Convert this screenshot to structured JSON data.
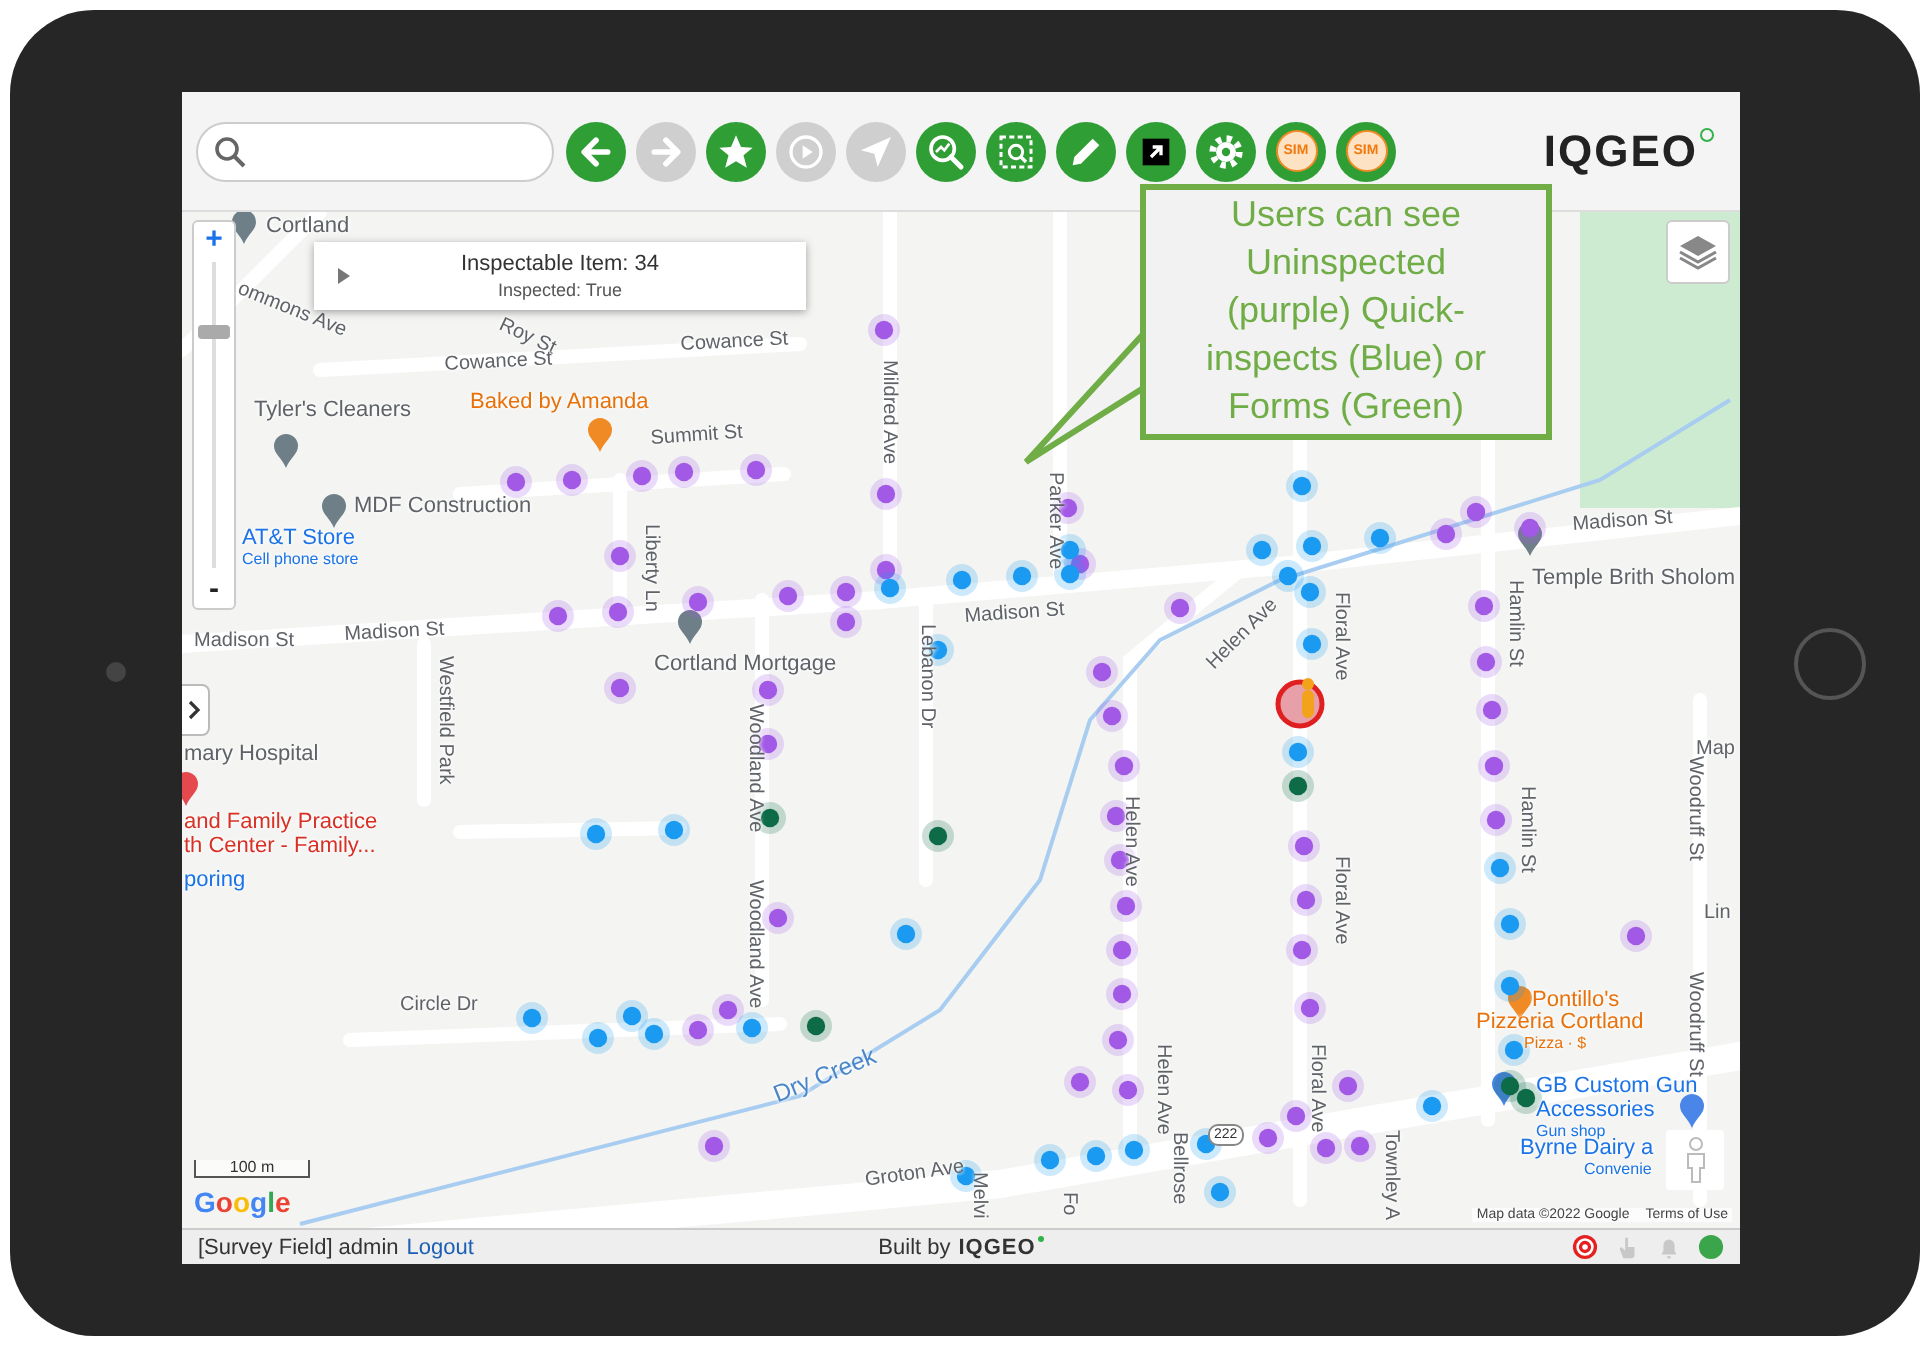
{
  "toolbar": {
    "buttons": [
      {
        "kind": "back",
        "disabled": false
      },
      {
        "kind": "forward",
        "disabled": true
      },
      {
        "kind": "star",
        "disabled": false
      },
      {
        "kind": "play",
        "disabled": true
      },
      {
        "kind": "locate",
        "disabled": true
      },
      {
        "kind": "zoom-chart",
        "disabled": false
      },
      {
        "kind": "zoom-select",
        "disabled": false
      },
      {
        "kind": "pencil",
        "disabled": false
      },
      {
        "kind": "export",
        "disabled": false
      },
      {
        "kind": "gear",
        "disabled": false
      },
      {
        "kind": "sim",
        "label": "SIM",
        "disabled": false
      },
      {
        "kind": "sim",
        "label": "SIM",
        "disabled": false
      }
    ],
    "logo": "IQGEO"
  },
  "callout": {
    "text": "Users can see Uninspected (purple) Quick-inspects (Blue) or Forms (Green)"
  },
  "popup": {
    "title": "Inspectable Item: 34",
    "subtitle": "Inspected: True"
  },
  "zoom": {
    "in": "+",
    "out": "-",
    "level": 0.77
  },
  "map_labels": [
    {
      "text": "Cortland",
      "kind": "place"
    },
    {
      "text": "ommons Ave",
      "kind": "street"
    },
    {
      "text": "Roy St",
      "kind": "street"
    },
    {
      "text": "Cowance St",
      "kind": "street"
    },
    {
      "text": "Cowance St",
      "kind": "street"
    },
    {
      "text": "Tyler's Cleaners",
      "kind": "place"
    },
    {
      "text": "Baked by Amanda",
      "kind": "food"
    },
    {
      "text": "Summit St",
      "kind": "street"
    },
    {
      "text": "MDF Construction",
      "kind": "place"
    },
    {
      "text": "AT&T Store",
      "kind": "blue"
    },
    {
      "text": "Cell phone store",
      "kind": "blue-small"
    },
    {
      "text": "Madison St",
      "kind": "street"
    },
    {
      "text": "Madison St",
      "kind": "street"
    },
    {
      "text": "Liberty Ln",
      "kind": "street"
    },
    {
      "text": "Madison St",
      "kind": "street"
    },
    {
      "text": "Madison St",
      "kind": "street"
    },
    {
      "text": "Cortland Mortgage",
      "kind": "place"
    },
    {
      "text": "Westfield Park",
      "kind": "street"
    },
    {
      "text": "Woodland Ave",
      "kind": "street"
    },
    {
      "text": "Mildred Ave",
      "kind": "street"
    },
    {
      "text": "Parker Ave",
      "kind": "street"
    },
    {
      "text": "Lebanon Dr",
      "kind": "street"
    },
    {
      "text": "Helen Ave",
      "kind": "street"
    },
    {
      "text": "Floral Ave",
      "kind": "street"
    },
    {
      "text": "Hamlin St",
      "kind": "street"
    },
    {
      "text": "Temple Brith Sholom",
      "kind": "place"
    },
    {
      "text": "mary Hospital",
      "kind": "place"
    },
    {
      "text": "and Family Practice",
      "kind": "red"
    },
    {
      "text": "th Center - Family...",
      "kind": "red"
    },
    {
      "text": "poring",
      "kind": "blue"
    },
    {
      "text": "Woodland Ave",
      "kind": "street"
    },
    {
      "text": "Helen Ave",
      "kind": "street"
    },
    {
      "text": "Floral Ave",
      "kind": "street"
    },
    {
      "text": "Hamlin St",
      "kind": "street"
    },
    {
      "text": "Woodruff St",
      "kind": "street"
    },
    {
      "text": "Map",
      "kind": "street"
    },
    {
      "text": "Circle Dr",
      "kind": "street"
    },
    {
      "text": "Dry Creek",
      "kind": "water"
    },
    {
      "text": "Helen Ave",
      "kind": "street"
    },
    {
      "text": "Floral Ave",
      "kind": "street"
    },
    {
      "text": "Woodruff St",
      "kind": "street"
    },
    {
      "text": "Lin",
      "kind": "street"
    },
    {
      "text": "Pontillo's",
      "kind": "food"
    },
    {
      "text": "Pizzeria Cortland",
      "kind": "food"
    },
    {
      "text": "Pizza · $",
      "kind": "food-small"
    },
    {
      "text": "GB Custom Gun",
      "kind": "blue"
    },
    {
      "text": "Accessories",
      "kind": "blue"
    },
    {
      "text": "Gun shop",
      "kind": "blue-small"
    },
    {
      "text": "Byrne Dairy a",
      "kind": "blue"
    },
    {
      "text": "Convenie",
      "kind": "blue-small"
    },
    {
      "text": "Groton Ave",
      "kind": "street"
    },
    {
      "text": "Fo",
      "kind": "street"
    },
    {
      "text": "Melvi",
      "kind": "street"
    },
    {
      "text": "Bellrose",
      "kind": "street"
    },
    {
      "text": "Townley A",
      "kind": "street"
    },
    {
      "text": "222",
      "kind": "shield"
    }
  ],
  "markers": [
    {
      "kind": "uninspected"
    },
    {
      "kind": "uninspected"
    },
    {
      "kind": "uninspected"
    },
    {
      "kind": "uninspected"
    },
    {
      "kind": "uninspected"
    },
    {
      "kind": "uninspected"
    },
    {
      "kind": "uninspected"
    },
    {
      "kind": "uninspected"
    },
    {
      "kind": "uninspected"
    },
    {
      "kind": "uninspected"
    },
    {
      "kind": "uninspected"
    },
    {
      "kind": "uninspected"
    },
    {
      "kind": "uninspected"
    },
    {
      "kind": "uninspected"
    },
    {
      "kind": "uninspected"
    },
    {
      "kind": "uninspected"
    },
    {
      "kind": "uninspected"
    },
    {
      "kind": "uninspected"
    },
    {
      "kind": "uninspected"
    },
    {
      "kind": "uninspected"
    },
    {
      "kind": "uninspected"
    },
    {
      "kind": "uninspected"
    },
    {
      "kind": "uninspected"
    },
    {
      "kind": "uninspected"
    },
    {
      "kind": "uninspected"
    },
    {
      "kind": "uninspected"
    },
    {
      "kind": "uninspected"
    },
    {
      "kind": "uninspected"
    },
    {
      "kind": "uninspected"
    },
    {
      "kind": "uninspected"
    },
    {
      "kind": "uninspected"
    },
    {
      "kind": "uninspected"
    },
    {
      "kind": "uninspected"
    },
    {
      "kind": "uninspected"
    },
    {
      "kind": "uninspected"
    },
    {
      "kind": "uninspected"
    },
    {
      "kind": "uninspected"
    },
    {
      "kind": "uninspected"
    },
    {
      "kind": "uninspected"
    },
    {
      "kind": "uninspected"
    },
    {
      "kind": "uninspected"
    },
    {
      "kind": "uninspected"
    },
    {
      "kind": "uninspected"
    },
    {
      "kind": "uninspected"
    },
    {
      "kind": "uninspected"
    },
    {
      "kind": "uninspected"
    },
    {
      "kind": "uninspected"
    },
    {
      "kind": "uninspected"
    },
    {
      "kind": "uninspected"
    },
    {
      "kind": "uninspected"
    },
    {
      "kind": "uninspected"
    },
    {
      "kind": "uninspected"
    },
    {
      "kind": "uninspected"
    },
    {
      "kind": "uninspected"
    },
    {
      "kind": "quick"
    },
    {
      "kind": "quick"
    },
    {
      "kind": "quick"
    },
    {
      "kind": "quick"
    },
    {
      "kind": "quick"
    },
    {
      "kind": "quick"
    },
    {
      "kind": "quick"
    },
    {
      "kind": "quick"
    },
    {
      "kind": "quick"
    },
    {
      "kind": "quick"
    },
    {
      "kind": "quick"
    },
    {
      "kind": "quick"
    },
    {
      "kind": "quick"
    },
    {
      "kind": "quick"
    },
    {
      "kind": "quick"
    },
    {
      "kind": "quick"
    },
    {
      "kind": "quick"
    },
    {
      "kind": "quick"
    },
    {
      "kind": "quick"
    },
    {
      "kind": "quick"
    },
    {
      "kind": "quick"
    },
    {
      "kind": "quick"
    },
    {
      "kind": "quick"
    },
    {
      "kind": "quick"
    },
    {
      "kind": "quick"
    },
    {
      "kind": "quick"
    },
    {
      "kind": "quick"
    },
    {
      "kind": "quick"
    },
    {
      "kind": "quick"
    },
    {
      "kind": "quick"
    },
    {
      "kind": "quick"
    },
    {
      "kind": "quick"
    },
    {
      "kind": "quick"
    },
    {
      "kind": "form"
    },
    {
      "kind": "form"
    },
    {
      "kind": "form"
    },
    {
      "kind": "form"
    },
    {
      "kind": "form"
    },
    {
      "kind": "form"
    }
  ],
  "map_footer": {
    "scale": "100 m",
    "google": "Google",
    "attribution": "Map data ©2022 Google",
    "terms": "Terms of Use"
  },
  "status_bar": {
    "user": "[Survey Field] admin",
    "logout": "Logout",
    "built_by": "Built by",
    "logo": "IQGEO"
  }
}
